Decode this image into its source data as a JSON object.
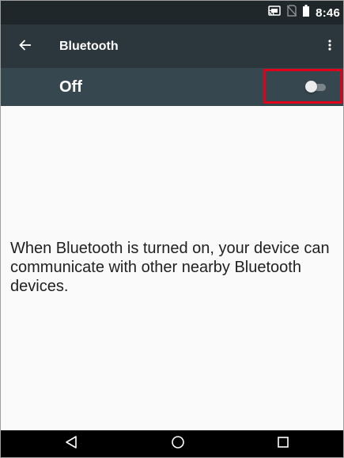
{
  "status_bar": {
    "time": "8:46",
    "icons": [
      "cast-icon",
      "no-sim-icon",
      "battery-icon"
    ]
  },
  "toolbar": {
    "title": "Bluetooth",
    "back_icon": "arrow-back-icon",
    "overflow_icon": "more-vert-icon"
  },
  "master_switch": {
    "label": "Off",
    "checked": false,
    "highlight_color": "#e1001a"
  },
  "content": {
    "message": "When Bluetooth is turned on, your device can communicate with other nearby Bluetooth devices."
  },
  "nav_bar": {
    "buttons": [
      "back-triangle-icon",
      "home-circle-icon",
      "recents-square-icon"
    ]
  },
  "colors": {
    "status_bar": "#1f272b",
    "toolbar": "#2b373d",
    "switch_bar": "#37474f",
    "background": "#fafafa"
  }
}
